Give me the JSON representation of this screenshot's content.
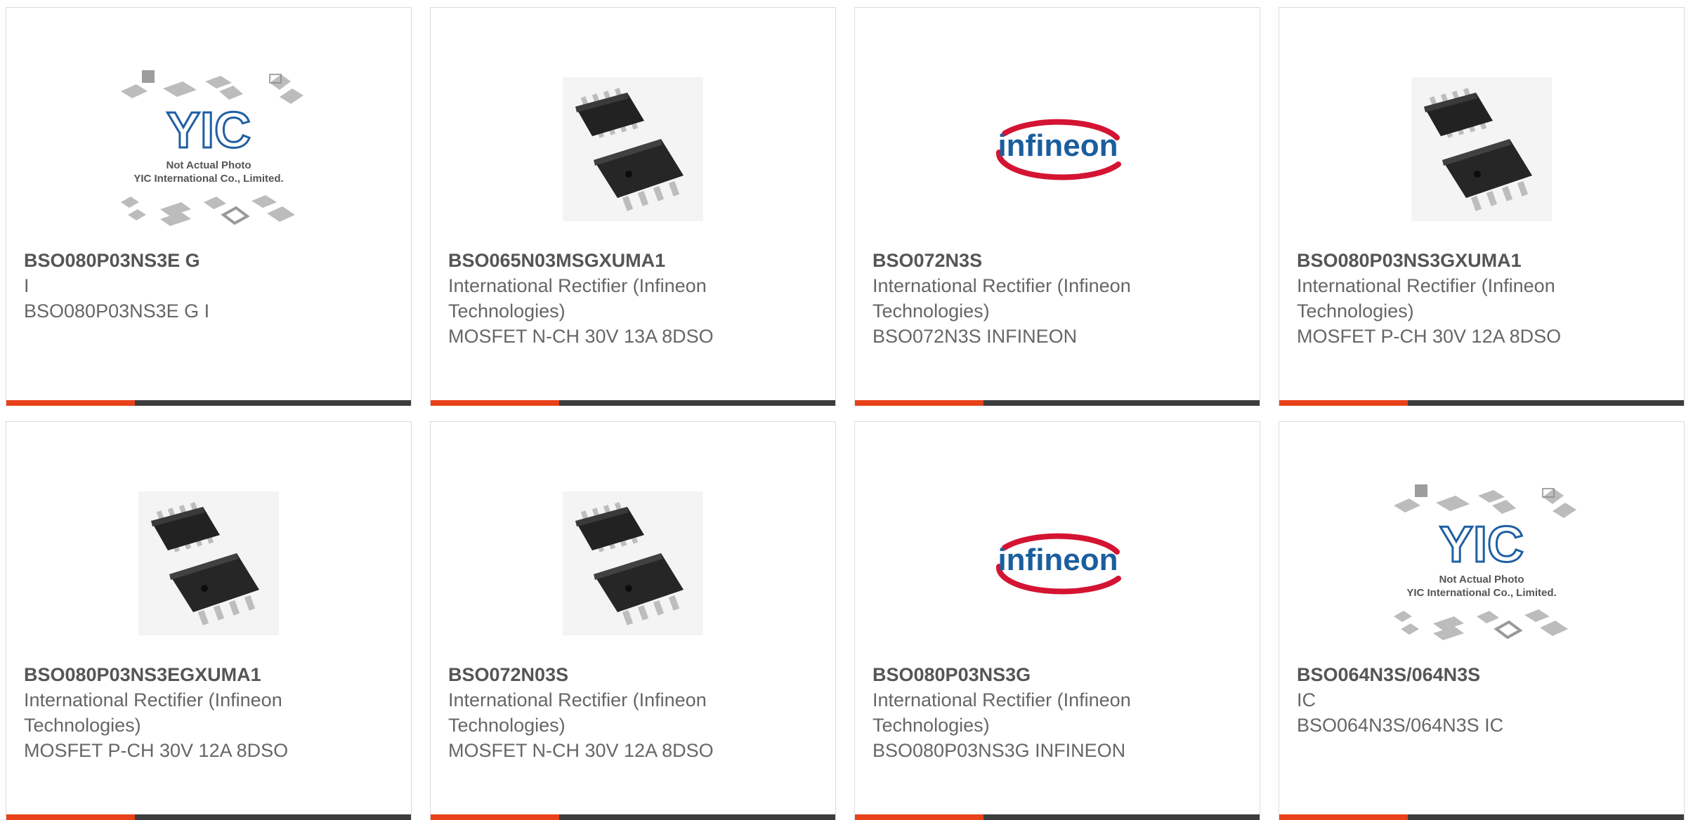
{
  "colors": {
    "accent": "#e8421a",
    "bar": "#3d3d3d",
    "part_text": "#555555",
    "body_text": "#666666",
    "infineon_red": "#d41432",
    "infineon_blue": "#1a5e9e"
  },
  "placeholder": {
    "line1": "Not Actual Photo",
    "line2": "YIC International Co., Limited."
  },
  "logo": {
    "text": "infineon"
  },
  "products": [
    {
      "part": "BSO080P03NS3E G",
      "manufacturer": "I",
      "description": "BSO080P03NS3E G I",
      "image": "yic-placeholder"
    },
    {
      "part": "BSO065N03MSGXUMA1",
      "manufacturer": "International Rectifier (Infineon Technologies)",
      "description": "MOSFET N-CH 30V 13A 8DSO",
      "image": "so8-chips"
    },
    {
      "part": "BSO072N3S",
      "manufacturer": "International Rectifier (Infineon Technologies)",
      "description": "BSO072N3S INFINEON",
      "image": "infineon-logo"
    },
    {
      "part": "BSO080P03NS3GXUMA1",
      "manufacturer": "International Rectifier (Infineon Technologies)",
      "description": "MOSFET P-CH 30V 12A 8DSO",
      "image": "so8-chips"
    },
    {
      "part": "BSO080P03NS3EGXUMA1",
      "manufacturer": "International Rectifier (Infineon Technologies)",
      "description": "MOSFET P-CH 30V 12A 8DSO",
      "image": "so8-chips"
    },
    {
      "part": "BSO072N03S",
      "manufacturer": "International Rectifier (Infineon Technologies)",
      "description": "MOSFET N-CH 30V 12A 8DSO",
      "image": "so8-chips"
    },
    {
      "part": "BSO080P03NS3G",
      "manufacturer": "International Rectifier (Infineon Technologies)",
      "description": "BSO080P03NS3G INFINEON",
      "image": "infineon-logo"
    },
    {
      "part": "BSO064N3S/064N3S",
      "manufacturer": "IC",
      "description": "BSO064N3S/064N3S IC",
      "image": "yic-placeholder"
    }
  ]
}
